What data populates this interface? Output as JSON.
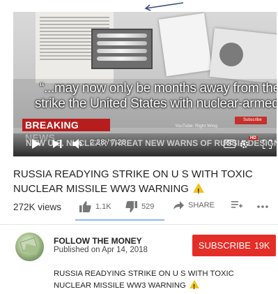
{
  "player": {
    "quote_line1": "“...may now only be months away from the capability to",
    "quote_line2": "strike the United States with nuclear-armed ballistic mis",
    "breaking_label": "BREAKING NEWS",
    "source_label": "YouTube: Right Wing",
    "subscribe_chip": "Subscribe",
    "ticker": "NEW U.S. NUCLEAR THREAT NEW WARNS OF RUSSIA DESIGN TORPEDO",
    "time": "2:28 / 7:28",
    "cc": "CC",
    "hd": "HD"
  },
  "video": {
    "title": "RUSSIA READYING STRIKE ON U S WITH TOXIC NUCLEAR MISSILE WW3 WARNING",
    "views": "272K views",
    "likes": "1.1K",
    "dislikes": "529",
    "share_label": "SHARE"
  },
  "channel": {
    "name": "FOLLOW THE MONEY",
    "published": "Published on Apr 14, 2018",
    "subscribe_label": "SUBSCRIBE",
    "subscriber_count": "19K"
  },
  "description": {
    "line1": "RUSSIA READYING STRIKE ON U S  WITH TOXIC",
    "line2": "NUCLEAR MISSILE   WW3 WARNING"
  },
  "colors": {
    "subscribe_red": "#e52d27",
    "breaking_red": "#b81d1d",
    "warning_yellow": "#f2c31b"
  }
}
